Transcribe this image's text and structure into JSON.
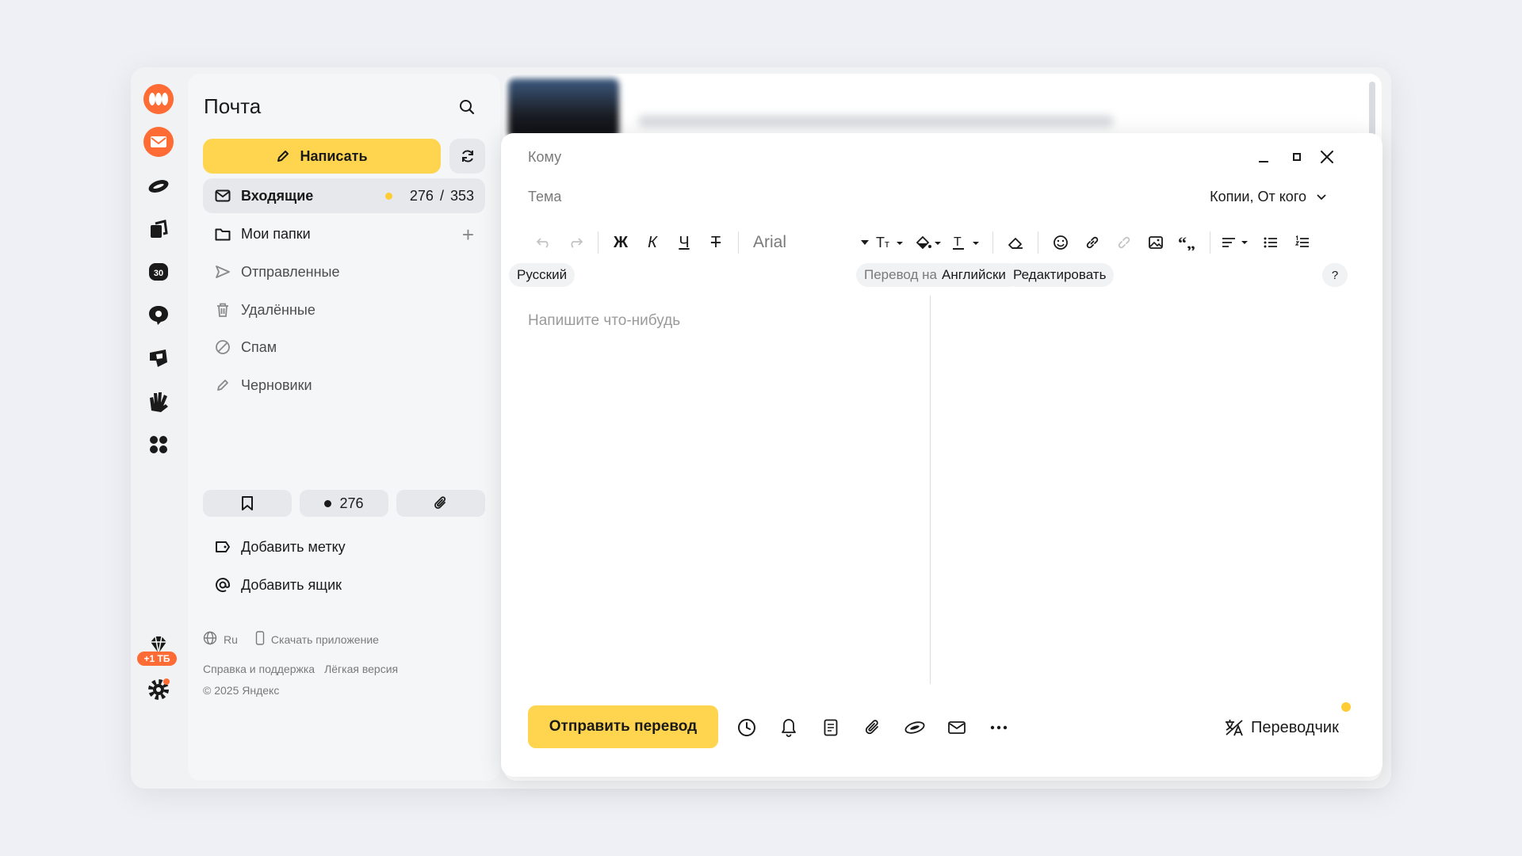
{
  "app": {
    "title": "Почта",
    "accent": "#ffd54f",
    "brand": "#ff6b35"
  },
  "rail": {
    "items": [
      "yandex-logo-icon",
      "mail-icon",
      "disk-icon",
      "docs-icon",
      "calendar-icon",
      "messenger-icon",
      "telemost-icon",
      "hands-icon",
      "apps-grid-icon"
    ],
    "storage_badge": "+1 ТБ",
    "settings_icon": "gear-icon"
  },
  "sidebar": {
    "compose_label": "Написать",
    "folders": [
      {
        "label": "Входящие",
        "unread": "276",
        "sep": "/",
        "total": "353"
      },
      {
        "label": "Мои папки"
      },
      {
        "label": "Отправленные"
      },
      {
        "label": "Удалённые"
      },
      {
        "label": "Спам"
      },
      {
        "label": "Черновики"
      }
    ],
    "chips": {
      "unread_count": "276"
    },
    "add_label": "Добавить метку",
    "add_mailbox": "Добавить ящик",
    "footer": {
      "lang": "Ru",
      "download": "Скачать приложение",
      "help": "Справка и поддержка",
      "lite": "Лёгкая версия",
      "copyright": "© 2025 Яндекс"
    }
  },
  "compose": {
    "to_placeholder": "Кому",
    "subject_placeholder": "Тема",
    "cc_label": "Копии, От кого",
    "font_name": "Arial",
    "toolbar": {
      "bold": "Ж",
      "italic": "К",
      "underline": "Ч",
      "strike": "Т"
    },
    "source_lang": "Русский",
    "translate_prefix": "Перевод на",
    "target_lang": "Английский",
    "edit_label": "Редактировать",
    "help_label": "?",
    "body_placeholder": "Напишите что-нибудь",
    "send_label": "Отправить перевод",
    "translator_label": "Переводчик"
  }
}
